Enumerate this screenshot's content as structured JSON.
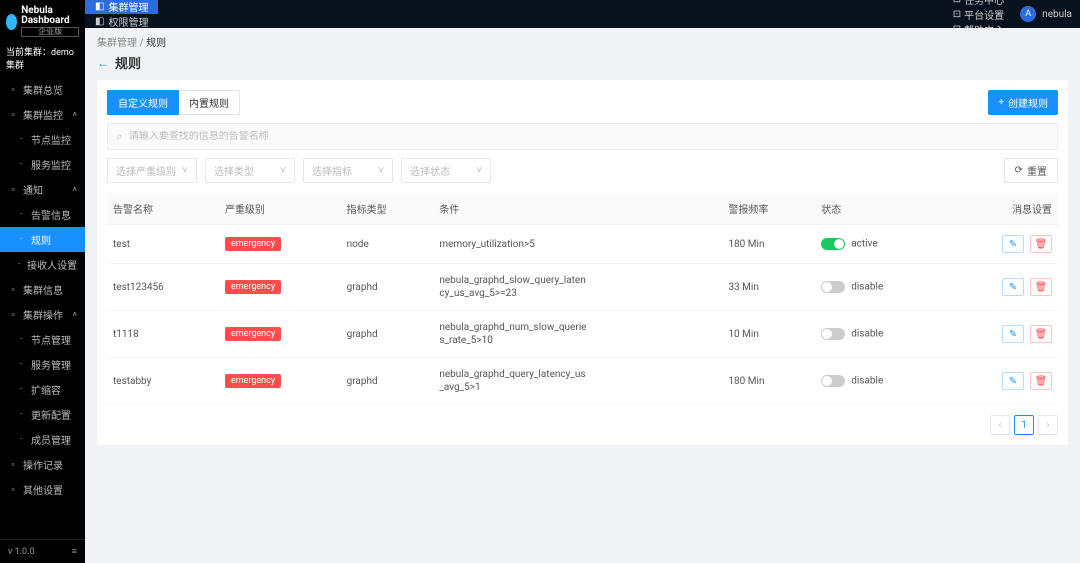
{
  "brand": {
    "title": "Nebula Dashboard",
    "edition": "企业版"
  },
  "current_cluster_label": "当前集群：",
  "current_cluster": "demo集群",
  "version": "v 1.0.0",
  "topbar": {
    "tabs": [
      {
        "label": "集群管理",
        "active": true,
        "icon": "cluster-icon"
      },
      {
        "label": "权限管理",
        "active": false,
        "icon": "perm-icon"
      }
    ],
    "right": [
      {
        "label": "任务中心",
        "icon": "tasks-icon"
      },
      {
        "label": "平台设置",
        "icon": "settings-icon"
      },
      {
        "label": "帮助中心",
        "icon": "help-icon"
      }
    ],
    "user": "nebula"
  },
  "sidebar": {
    "groups": [
      {
        "title": "集群总览",
        "icon": "overview-icon",
        "collapsible": false
      },
      {
        "title": "集群监控",
        "icon": "monitor-icon",
        "expanded": true,
        "items": [
          {
            "label": "节点监控"
          },
          {
            "label": "服务监控"
          }
        ]
      },
      {
        "title": "通知",
        "icon": "bell-icon",
        "expanded": true,
        "items": [
          {
            "label": "告警信息"
          },
          {
            "label": "规则",
            "active": true
          },
          {
            "label": "接收人设置"
          }
        ]
      },
      {
        "title": "集群信息",
        "icon": "info-icon",
        "collapsible": false
      },
      {
        "title": "集群操作",
        "icon": "ops-icon",
        "expanded": true,
        "items": [
          {
            "label": "节点管理"
          },
          {
            "label": "服务管理"
          },
          {
            "label": "扩缩容"
          },
          {
            "label": "更新配置"
          },
          {
            "label": "成员管理"
          }
        ]
      },
      {
        "title": "操作记录",
        "icon": "log-icon",
        "collapsible": false
      },
      {
        "title": "其他设置",
        "icon": "other-icon",
        "collapsible": false
      }
    ]
  },
  "breadcrumb": {
    "a": "集群管理",
    "b": "规则"
  },
  "page_title": "规则",
  "tabs": {
    "custom": "自定义规则",
    "builtin": "内置规则"
  },
  "create_button": "创建规则",
  "search": {
    "placeholder": "请输入要查找的信息的告警名称"
  },
  "filters": {
    "severity": "选择严重级别",
    "type": "选择类型",
    "metric": "选择指标",
    "status": "选择状态",
    "reset": "重置"
  },
  "columns": {
    "name": "告警名称",
    "severity": "严重级别",
    "metric_type": "指标类型",
    "condition": "条件",
    "freq": "警报频率",
    "status": "状态",
    "msg": "消息设置"
  },
  "status_labels": {
    "active": "active",
    "disable": "disable"
  },
  "rows": [
    {
      "name": "test",
      "severity": "emergency",
      "metric_type": "node",
      "condition": "memory_utilization>5",
      "freq": "180 Min",
      "active": true
    },
    {
      "name": "test123456",
      "severity": "emergency",
      "metric_type": "graphd",
      "condition": "nebula_graphd_slow_query_latency_us_avg_5>=23",
      "freq": "33 Min",
      "active": false
    },
    {
      "name": "t1118",
      "severity": "emergency",
      "metric_type": "graphd",
      "condition": "nebula_graphd_num_slow_queries_rate_5>10",
      "freq": "10 Min",
      "active": false
    },
    {
      "name": "testabby",
      "severity": "emergency",
      "metric_type": "graphd",
      "condition": "nebula_graphd_query_latency_us_avg_5>1",
      "freq": "180 Min",
      "active": false
    }
  ],
  "pagination": {
    "page": "1"
  }
}
